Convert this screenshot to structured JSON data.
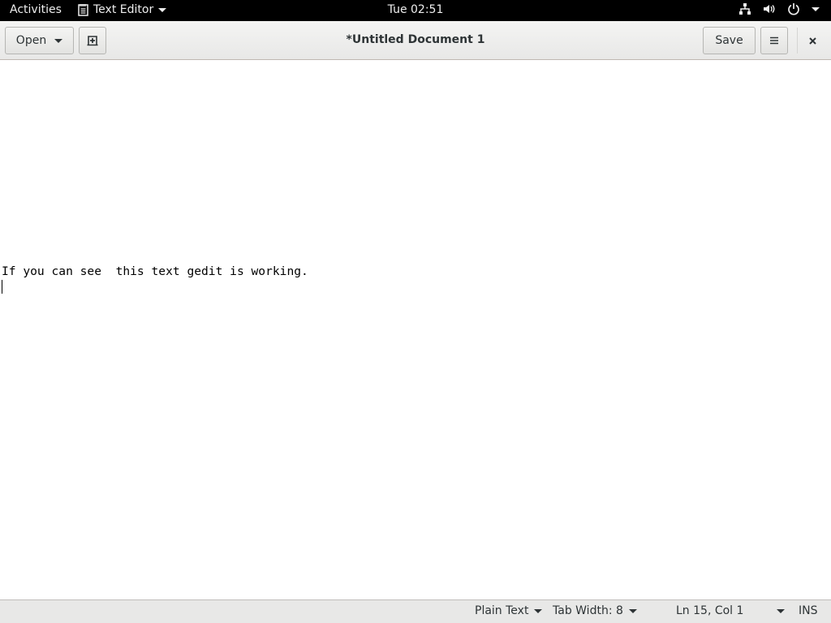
{
  "topbar": {
    "activities": "Activities",
    "app_name": "Text Editor",
    "clock": "Tue 02:51"
  },
  "header": {
    "open_label": "Open",
    "title": "*Untitled Document 1",
    "save_label": "Save"
  },
  "editor": {
    "blank_lines": 13,
    "text_line": "If you can see  this text gedit is working."
  },
  "status": {
    "language": "Plain Text",
    "tab_width": "Tab Width: 8",
    "position": "Ln 15, Col 1",
    "mode": "INS"
  }
}
